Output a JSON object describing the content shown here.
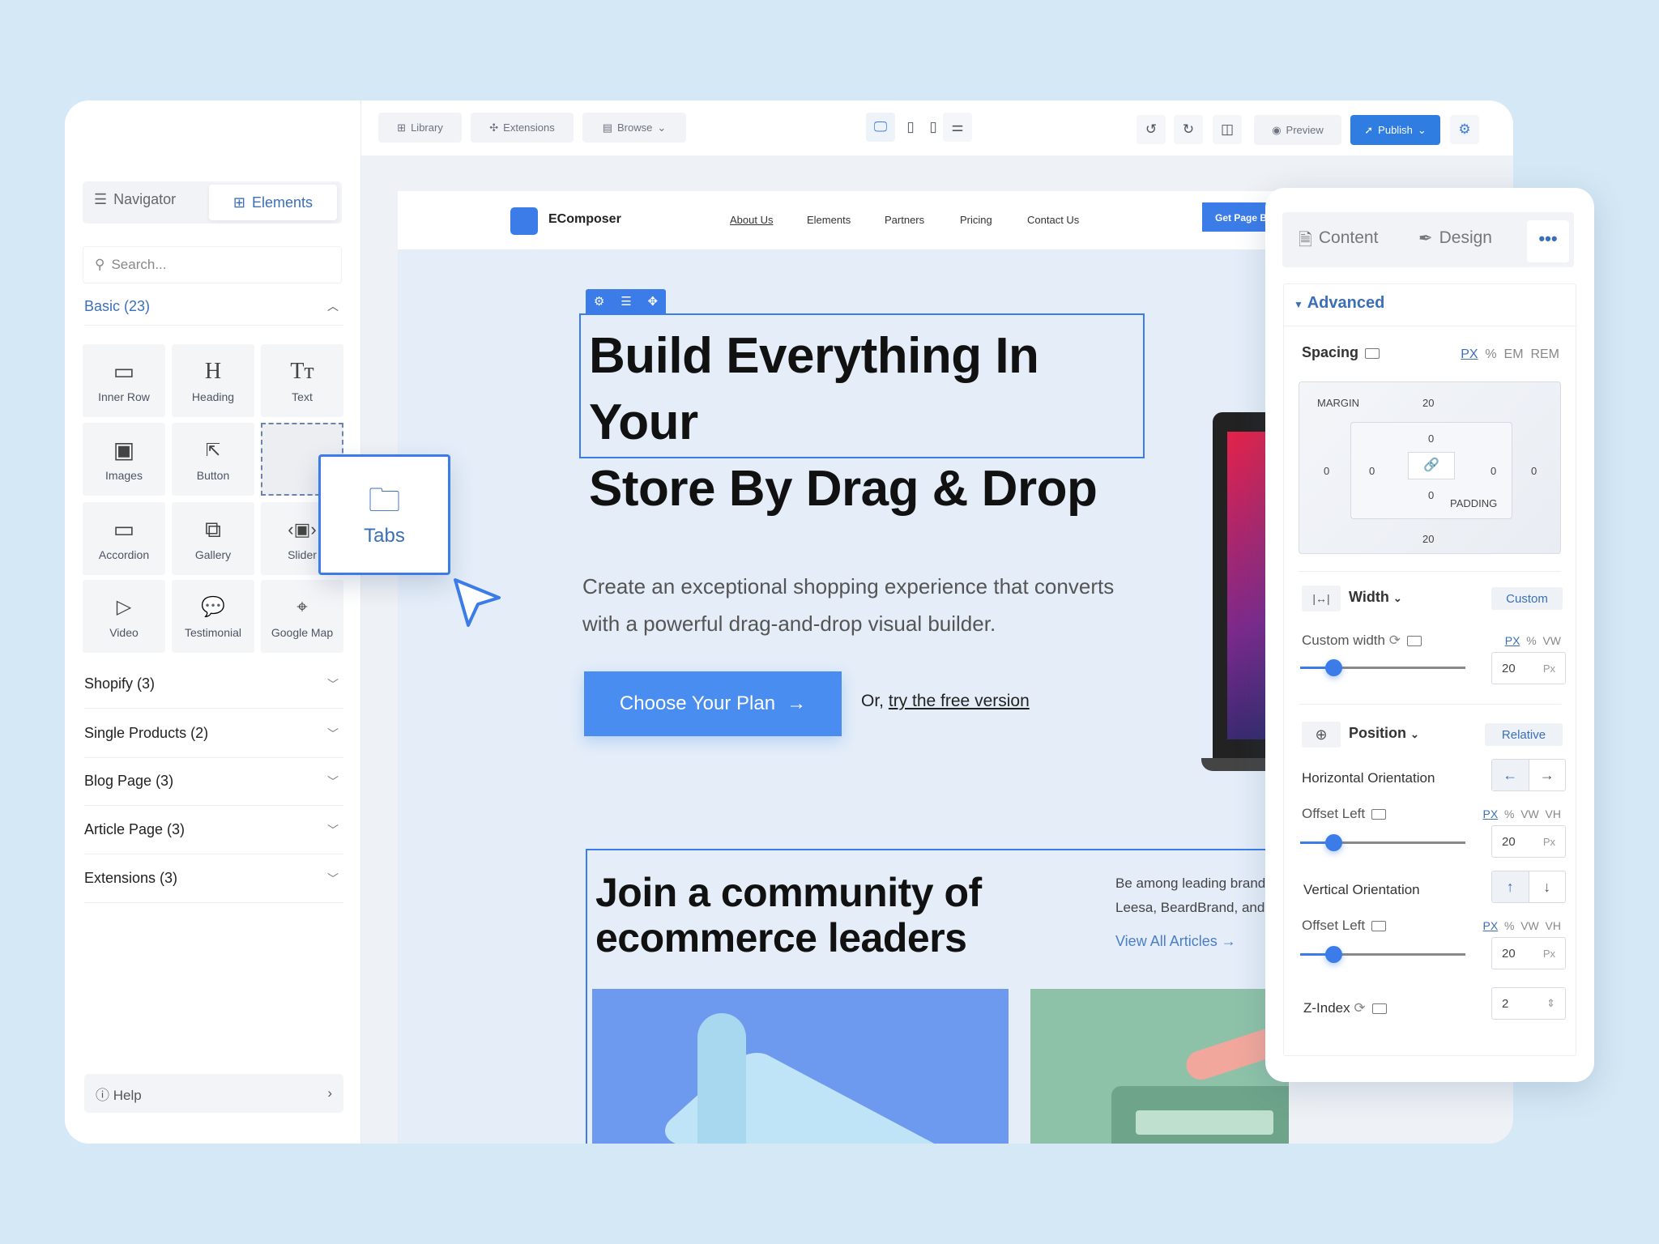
{
  "toolbar": {
    "library": "Library",
    "extensions": "Extensions",
    "browse": "Browse",
    "preview": "Preview",
    "publish": "Publish",
    "accent": "#2f7de1"
  },
  "sidebar": {
    "tabs": [
      {
        "label": "Navigator",
        "icon": "list-icon"
      },
      {
        "label": "Elements",
        "icon": "elements-icon",
        "active": true
      }
    ],
    "search_placeholder": "Search...",
    "basic_label": "Basic (23)",
    "tiles": [
      {
        "label": "Inner Row",
        "icon": "inner-row-icon"
      },
      {
        "label": "Heading",
        "icon": "heading-icon"
      },
      {
        "label": "Text",
        "icon": "text-icon"
      },
      {
        "label": "Images",
        "icon": "image-icon"
      },
      {
        "label": "Button",
        "icon": "click-icon"
      },
      {
        "label": "Accordion",
        "icon": "accordion-icon"
      },
      {
        "label": "Gallery",
        "icon": "gallery-icon"
      },
      {
        "label": "Slider",
        "icon": "slider-icon"
      },
      {
        "label": "Video",
        "icon": "video-icon"
      },
      {
        "label": "Testimonial",
        "icon": "testimonial-icon"
      },
      {
        "label": "Google Map",
        "icon": "map-pin-icon"
      }
    ],
    "categories": [
      "Shopify (3)",
      "Single Products (2)",
      "Blog Page (3)",
      "Article Page (3)",
      "Extensions (3)"
    ],
    "help": "Help"
  },
  "drag": {
    "label": "Tabs"
  },
  "site": {
    "brand": "EComposer",
    "nav": [
      "About Us",
      "Elements",
      "Partners",
      "Pricing",
      "Contact Us"
    ],
    "cta_top": "Get Page B",
    "hero_title_1": "Build Everything In Your",
    "hero_title_2": "Store By Drag & Drop",
    "hero_sub_1": "Create an exceptional shopping experience that converts",
    "hero_sub_2": "with a powerful drag-and-drop visual builder.",
    "hero_button": "Choose Your Plan",
    "or_text": "Or,",
    "free_link": "try the free version",
    "community_1": "Join a community of",
    "community_2": "ecommerce leaders",
    "brands_1": "Be among leading brands like MVI",
    "brands_2": "Leesa, BeardBrand, and K-Swiss tl",
    "articles_link": "View All Articles →"
  },
  "panel": {
    "tabs": [
      "Content",
      "Design"
    ],
    "section": "Advanced",
    "spacing": "Spacing",
    "spacing_units": [
      "PX",
      "%",
      "EM",
      "REM"
    ],
    "margin_label": "MARGIN",
    "padding_label": "PADDING",
    "margin": {
      "top": "20",
      "right": "0",
      "bottom": "20",
      "left": "0"
    },
    "padding": {
      "top": "0",
      "right": "0",
      "bottom": "0",
      "left": "0"
    },
    "width_label": "Width",
    "width_value": "Custom",
    "custom_width": "Custom width",
    "units_pv": [
      "PX",
      "%",
      "VW"
    ],
    "units_pvv": [
      "PX",
      "%",
      "VW",
      "VH"
    ],
    "custom_width_value": "20",
    "px": "Px",
    "position_label": "Position",
    "position_value": "Relative",
    "horizontal": "Horizontal Orientation",
    "vertical": "Vertical Orientation",
    "offset_left": "Offset Left",
    "offset_left_value": "20",
    "offset_left_2": "Offset Left",
    "offset_left_2_value": "20",
    "slider_fraction": 0.2,
    "zindex_label": "Z-Index",
    "zindex_value": "2"
  }
}
